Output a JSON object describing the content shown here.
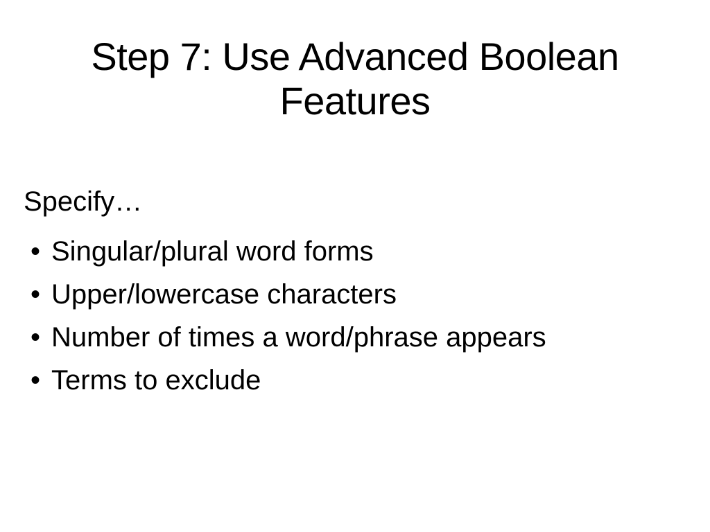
{
  "slide": {
    "title": "Step 7: Use Advanced Boolean Features",
    "intro": "Specify…",
    "bullets": [
      "Singular/plural word forms",
      "Upper/lowercase characters",
      "Number of times a word/phrase appears",
      "Terms to exclude"
    ]
  }
}
